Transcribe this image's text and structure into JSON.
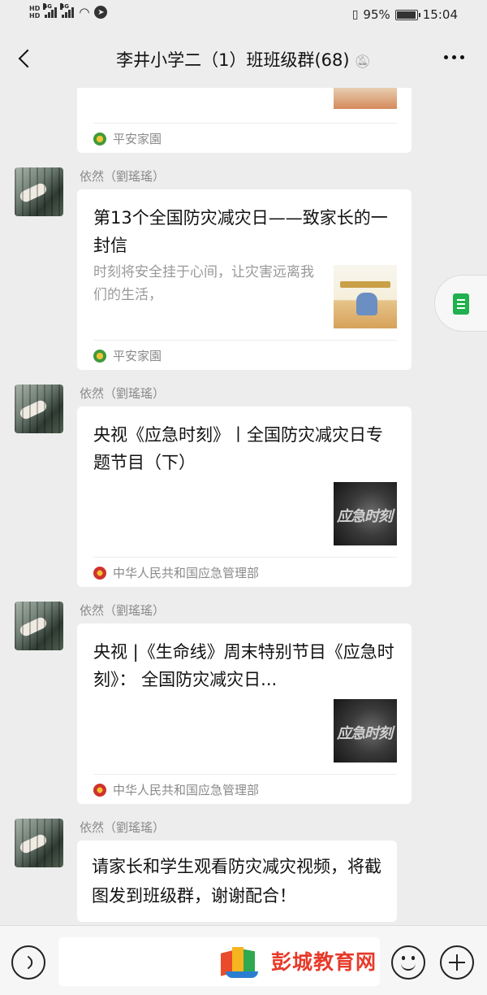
{
  "status_bar": {
    "hd1": "HD",
    "hd2": "HD",
    "net1": "4G",
    "net2": "4G",
    "battery": "95%",
    "battery_level": 0.95,
    "time": "15:04"
  },
  "header": {
    "title": "李井小学二（1）班班级群(68)",
    "icons": [
      "back-arrow-icon",
      "mute-bell-icon",
      "more-icon"
    ]
  },
  "messages": [
    {
      "type": "link_card_partial",
      "source": "平安家園"
    },
    {
      "type": "link_card",
      "sender": "依然（劉瑤瑤）",
      "title": "第13个全国防灾减灾日——致家长的一封信",
      "description": "时刻将安全挂于心间，让灾害远离我们的生活，",
      "source": "平安家園"
    },
    {
      "type": "link_card",
      "sender": "依然（劉瑤瑤）",
      "title": "央视《应急时刻》丨全国防灾减灾日专题节目（下）",
      "thumb_text": "应急时刻",
      "source": "中华人民共和国应急管理部"
    },
    {
      "type": "link_card",
      "sender": "依然（劉瑤瑤）",
      "title": "央视 |《生命线》周末特别节目《应急时刻》： 全国防灾减灾日...",
      "thumb_text": "应急时刻",
      "source": "中华人民共和国应急管理部"
    },
    {
      "type": "text",
      "sender": "依然（劉瑤瑤）",
      "text": "请家长和学生观看防灾减灾视频，将截图发到班级群，谢谢配合！"
    }
  ],
  "watermark": {
    "text": "彭城教育网"
  },
  "colors": {
    "background": "#ededed",
    "card": "#ffffff",
    "accent_green": "#21b04e",
    "watermark_red": "#e73a2a"
  }
}
